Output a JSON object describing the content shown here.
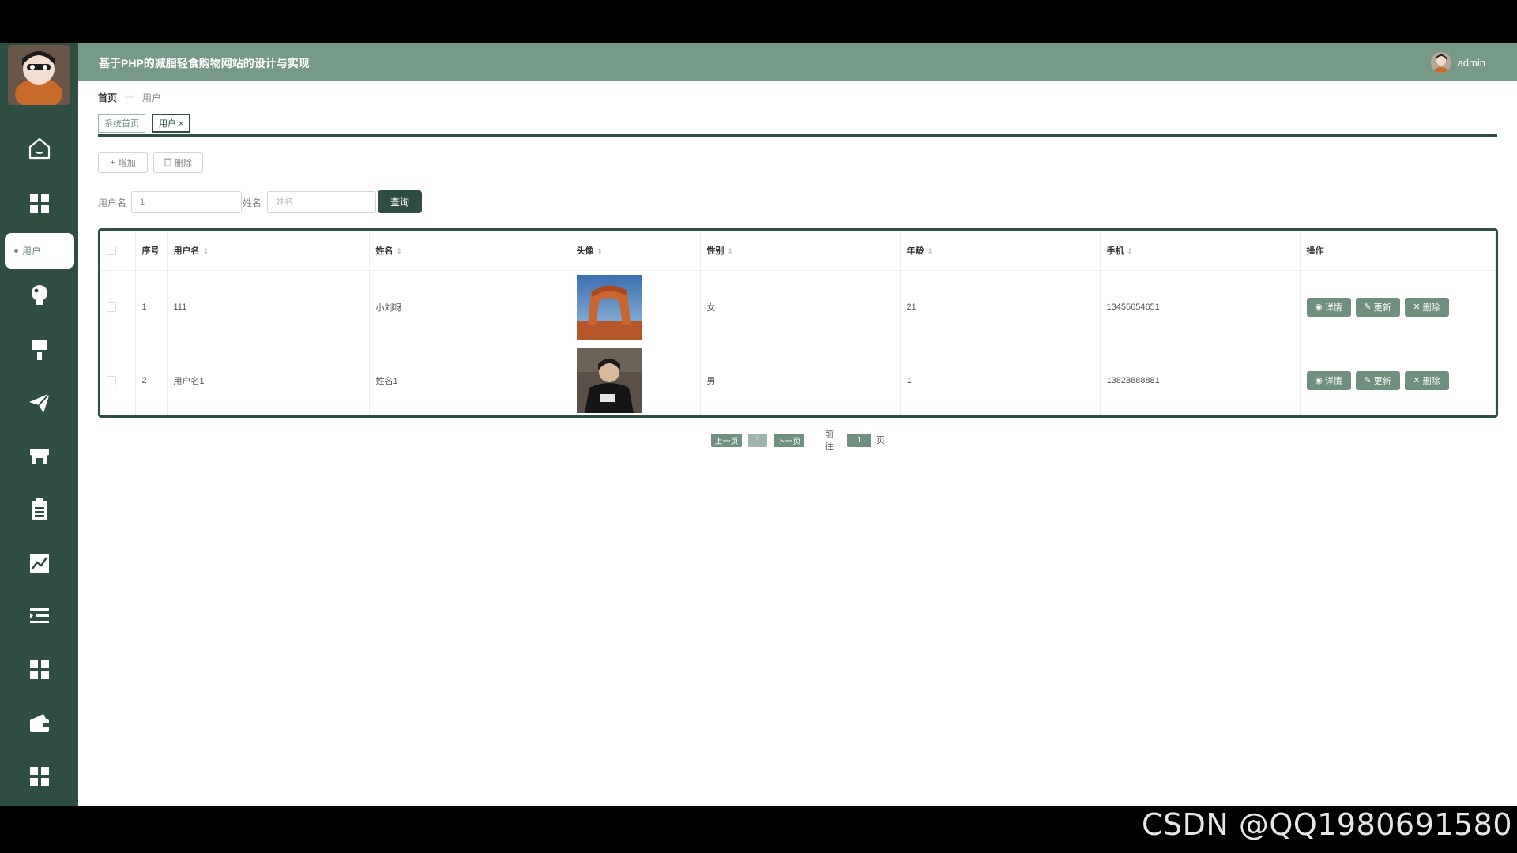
{
  "header": {
    "title": "基于PHP的减脂轻食购物网站的设计与实现",
    "username": "admin"
  },
  "sidebar": {
    "active_label": "用户",
    "icons": [
      "home-icon",
      "grid-icon",
      "bulb-icon",
      "brush-icon",
      "send-icon",
      "store-icon",
      "clipboard-icon",
      "chart-icon",
      "list-icon",
      "grid-icon-2",
      "wallet-icon",
      "grid-icon-3"
    ]
  },
  "breadcrumb": {
    "home": "首页",
    "separator": "—",
    "current": "用户"
  },
  "tabs": [
    {
      "label": "系统首页"
    },
    {
      "label": "用户 ×"
    }
  ],
  "toolbar": {
    "add_label": "增加",
    "delete_label": "删除"
  },
  "search": {
    "username_label": "用户名",
    "username_value": "1",
    "name_label": "姓名",
    "name_placeholder": "姓名",
    "query_label": "查询"
  },
  "table": {
    "columns": [
      "序号",
      "用户名",
      "姓名",
      "头像",
      "性别",
      "年龄",
      "手机",
      "操作"
    ],
    "rows": [
      {
        "index": "1",
        "username": "111",
        "name": "小刘呀",
        "gender": "女",
        "age": "21",
        "phone": "13455654651"
      },
      {
        "index": "2",
        "username": "用户名1",
        "name": "姓名1",
        "gender": "男",
        "age": "1",
        "phone": "13823888881"
      }
    ],
    "actions": {
      "detail": "详情",
      "update": "更新",
      "delete": "删除"
    }
  },
  "pagination": {
    "prev": "上一页",
    "page": "1",
    "next": "下一页",
    "goto_label": "前往",
    "goto_value": "1",
    "page_suffix": "页"
  },
  "watermark": "CSDN @QQ1980691580",
  "colors": {
    "sidebar": "#2f4e42",
    "header": "#779a88",
    "accent": "#6f8f7f"
  }
}
